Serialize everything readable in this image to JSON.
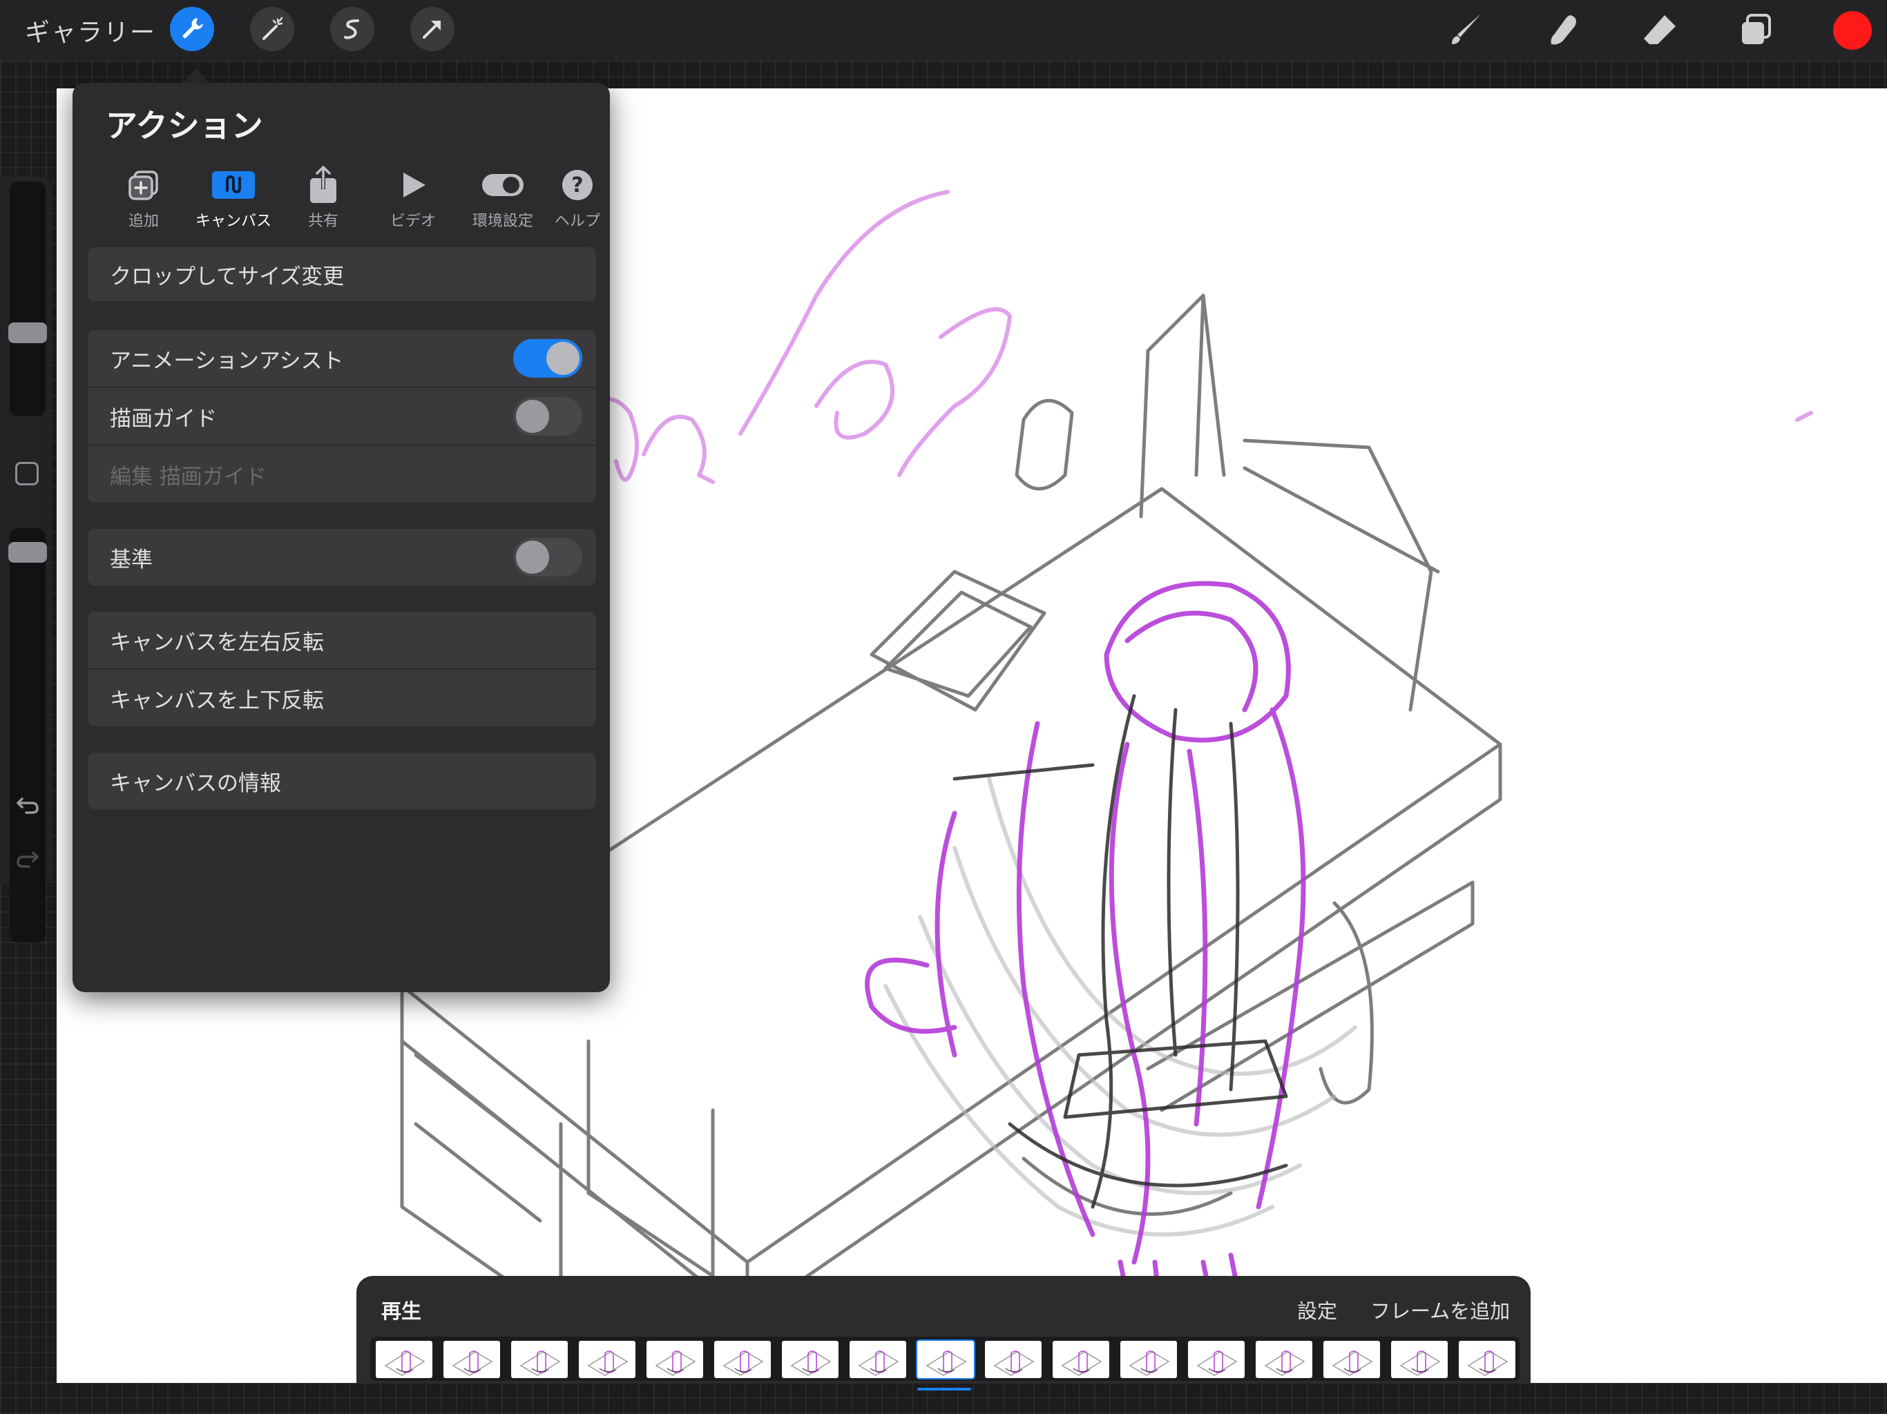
{
  "topbar": {
    "gallery_label": "ギャラリー",
    "left_tools": [
      "wrench-icon",
      "magic-wand-icon",
      "selection-icon",
      "transform-icon"
    ],
    "right_tools": [
      "brush-icon",
      "smudge-icon",
      "eraser-icon",
      "layers-icon"
    ],
    "current_color": "#ff1a1a"
  },
  "actions_panel": {
    "title": "アクション",
    "tabs": [
      {
        "label": "追加",
        "icon": "add-image-icon",
        "active": false
      },
      {
        "label": "キャンバス",
        "icon": "canvas-icon",
        "active": true
      },
      {
        "label": "共有",
        "icon": "share-icon",
        "active": false
      },
      {
        "label": "ビデオ",
        "icon": "play-icon",
        "active": false
      },
      {
        "label": "環境設定",
        "icon": "toggle-icon",
        "active": false
      },
      {
        "label": "ヘルプ",
        "icon": "help-icon",
        "active": false
      }
    ],
    "rows": {
      "crop": "クロップしてサイズ変更",
      "animation_assist": "アニメーションアシスト",
      "drawing_guide": "描画ガイド",
      "edit_drawing_guide": "編集 描画ガイド",
      "reference": "基準",
      "flip_horizontal": "キャンバスを左右反転",
      "flip_vertical": "キャンバスを上下反転",
      "canvas_info": "キャンバスの情報"
    },
    "toggles": {
      "animation_assist": true,
      "drawing_guide": false,
      "reference": false
    }
  },
  "timeline": {
    "play_label": "再生",
    "settings_label": "設定",
    "add_frame_label": "フレームを追加",
    "frame_count": 17,
    "current_frame": 9
  },
  "colors": {
    "accent": "#1a7ff0",
    "sketch_purple": "#b43bd8",
    "sketch_gray": "#6e6e6e"
  }
}
